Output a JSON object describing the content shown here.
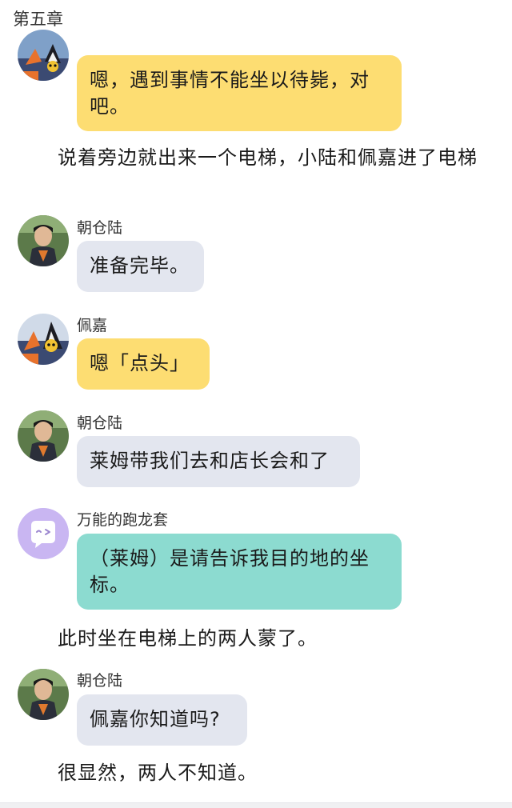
{
  "chapter": {
    "title": "第五章"
  },
  "messages": [
    {
      "type": "bubble",
      "speaker": "",
      "text": "嗯，遇到事情不能坐以待毙，对吧。",
      "color": "#fddd72",
      "avatar_icon": "anime-character-avatar-icon"
    },
    {
      "type": "narration",
      "text": "说着旁边就出来一个电梯，小陆和佩嘉进了电梯"
    },
    {
      "type": "bubble",
      "speaker": "朝仓陆",
      "text": "准备完毕。",
      "color": "#e3e6ef",
      "avatar_icon": "person-photo-avatar-icon"
    },
    {
      "type": "bubble",
      "speaker": "佩嘉",
      "text": "嗯「点头」",
      "color": "#fddd72",
      "avatar_icon": "anime-character-avatar-icon"
    },
    {
      "type": "bubble",
      "speaker": "朝仓陆",
      "text": "莱姆带我们去和店长会和了",
      "color": "#e3e6ef",
      "avatar_icon": "person-photo-avatar-icon"
    },
    {
      "type": "bubble",
      "speaker": "万能的跑龙套",
      "text": "（莱姆）是请告诉我目的地的坐标。",
      "color": "#8cdbd0",
      "avatar_icon": "chat-bubble-wink-avatar-icon"
    },
    {
      "type": "narration",
      "text": "此时坐在电梯上的两人蒙了。"
    },
    {
      "type": "bubble",
      "speaker": "朝仓陆",
      "text": "佩嘉你知道吗?",
      "color": "#e3e6ef",
      "avatar_icon": "person-photo-avatar-icon"
    },
    {
      "type": "narration",
      "text": "很显然，两人不知道。"
    }
  ],
  "colors": {
    "accent_purple": "#c9b6f2",
    "yellow": "#fddd72",
    "gray": "#e3e6ef",
    "teal": "#8cdbd0"
  }
}
